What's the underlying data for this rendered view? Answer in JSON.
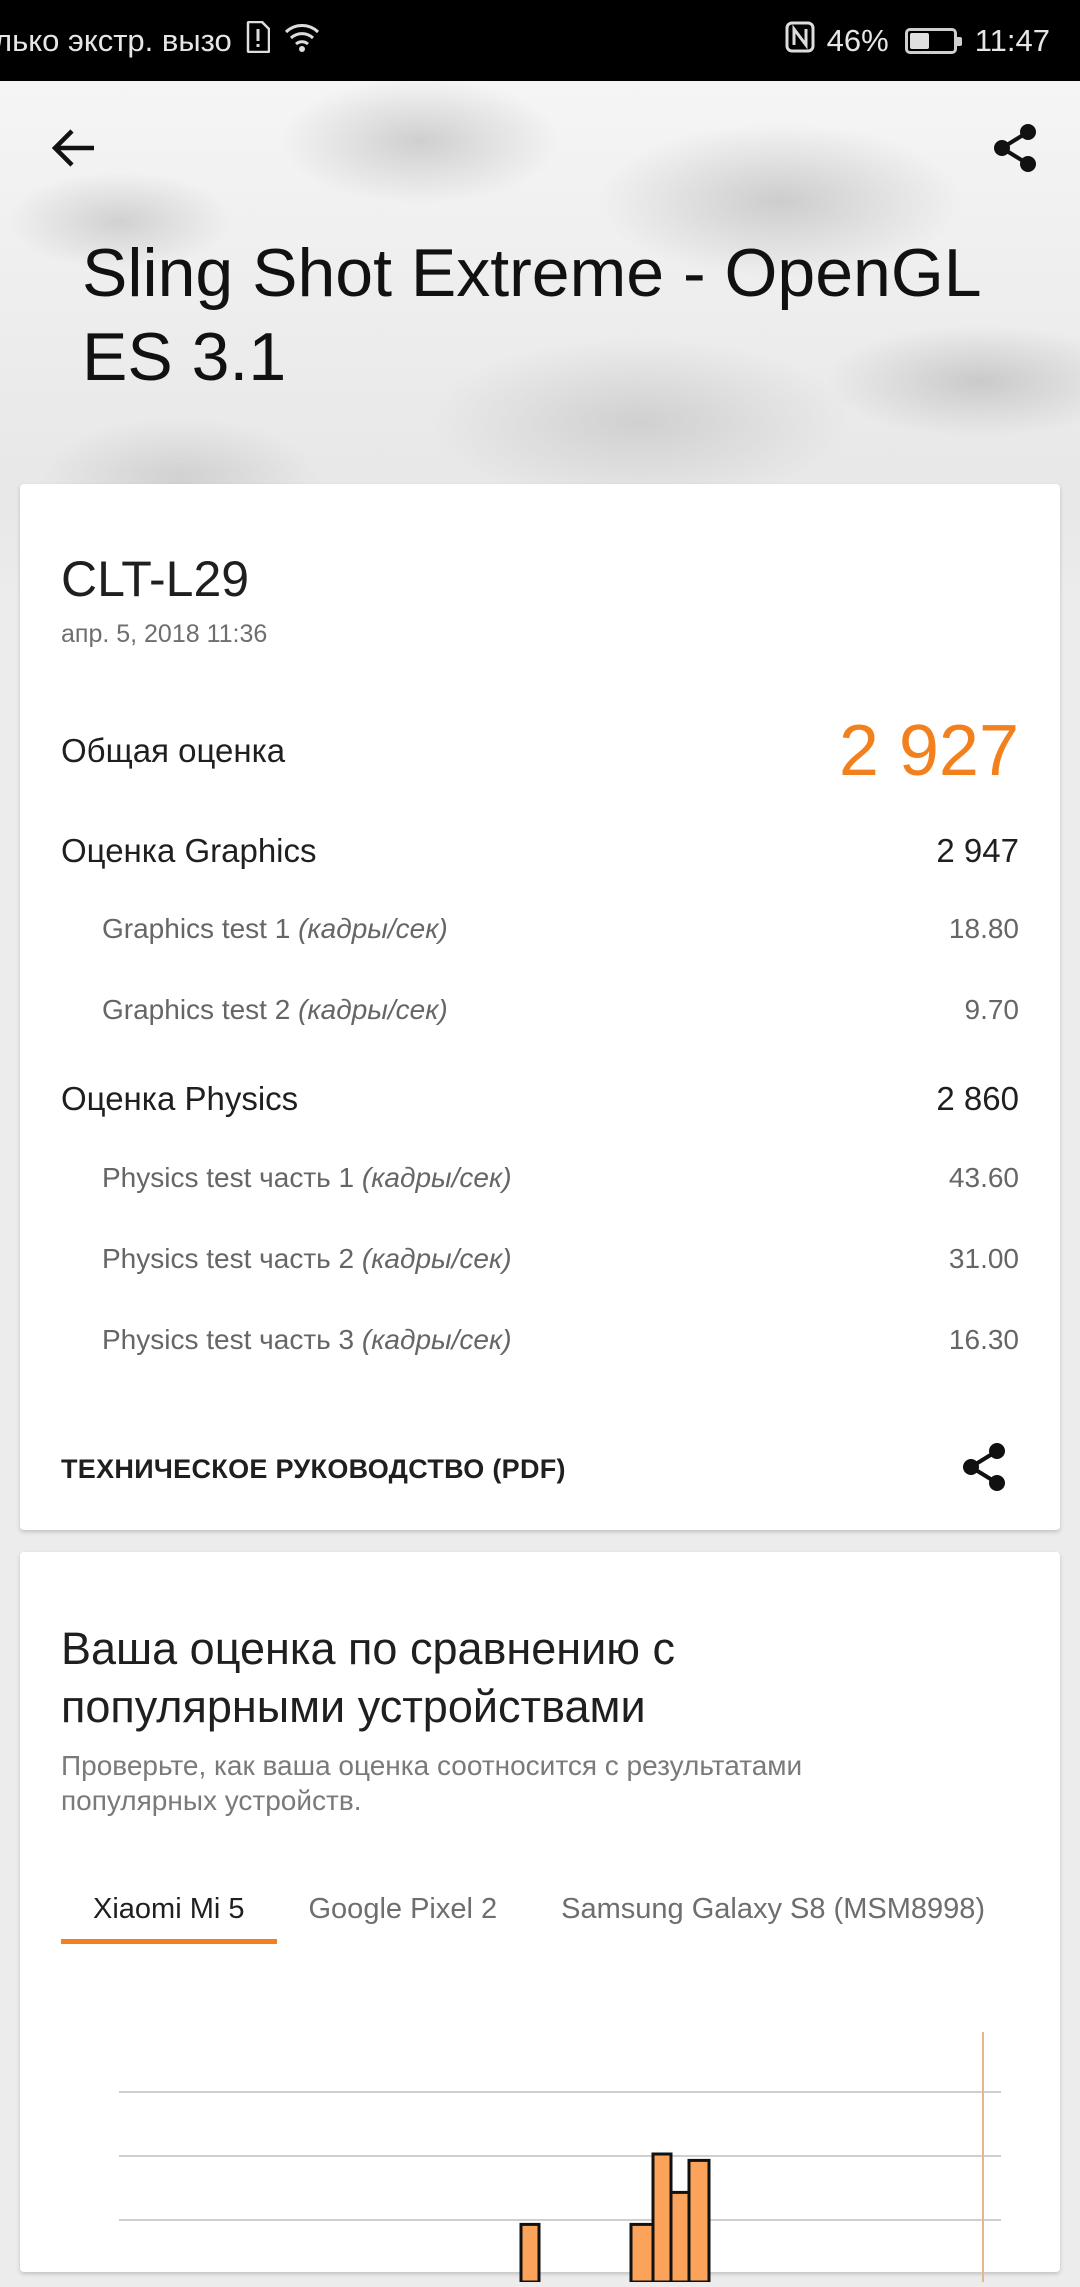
{
  "status_bar": {
    "carrier": "лько экстр. вызо",
    "battery_percent_text": "46%",
    "battery_level": 0.46,
    "time": "11:47",
    "icons": [
      "sim-alert-icon",
      "wifi-icon",
      "nfc-icon",
      "battery-icon"
    ]
  },
  "header": {
    "title": "Sling Shot Extreme - OpenGL ES 3.1",
    "icons": [
      "arrow-left-icon",
      "share-icon"
    ]
  },
  "result": {
    "device": "CLT-L29",
    "date": "апр. 5, 2018 11:36",
    "overall": {
      "label": "Общая оценка",
      "value": "2 927"
    },
    "rows": [
      {
        "level": 1,
        "label": "Оценка Graphics",
        "unit": "",
        "value": "2 947"
      },
      {
        "level": 2,
        "label": "Graphics test 1",
        "unit": "(кадры/сек)",
        "value": "18.80"
      },
      {
        "level": 2,
        "label": "Graphics test 2",
        "unit": "(кадры/сек)",
        "value": "9.70"
      },
      {
        "level": 1,
        "label": "Оценка Physics",
        "unit": "",
        "value": "2 860"
      },
      {
        "level": 2,
        "label": "Physics test часть 1",
        "unit": "(кадры/сек)",
        "value": "43.60"
      },
      {
        "level": 2,
        "label": "Physics test часть 2",
        "unit": "(кадры/сек)",
        "value": "31.00"
      },
      {
        "level": 2,
        "label": "Physics test часть 3",
        "unit": "(кадры/сек)",
        "value": "16.30"
      }
    ],
    "pdf_label": "ТЕХНИЧЕСКОЕ РУКОВОДСТВО (PDF)"
  },
  "compare": {
    "title": "Ваша оценка по сравнению с популярными устройствами",
    "subtitle": "Проверьте, как ваша оценка соотносится с результатами популярных устройств.",
    "tabs": [
      "Xiaomi Mi 5",
      "Google Pixel 2",
      "Samsung Galaxy S8 (MSM8998)"
    ],
    "active_tab": 0
  },
  "colors": {
    "accent": "#f2811d",
    "histogram_fill": "#fba35a",
    "marker_line": "#e0b98c"
  },
  "chart_data": {
    "type": "bar",
    "series": [
      {
        "values": [
          0.9,
          2.0,
          1.4,
          1.9
        ]
      }
    ]
  }
}
